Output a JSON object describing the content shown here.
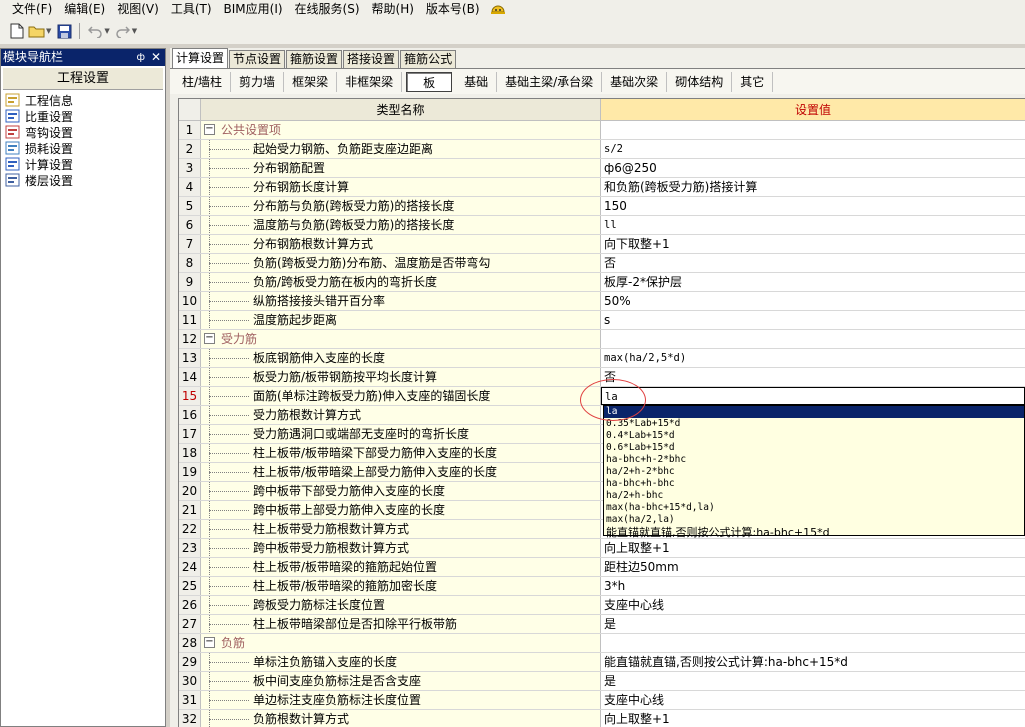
{
  "menu": [
    "文件(F)",
    "编辑(E)",
    "视图(V)",
    "工具(T)",
    "BIM应用(I)",
    "在线服务(S)",
    "帮助(H)",
    "版本号(B)"
  ],
  "left": {
    "title": "模块导航栏",
    "pin": "ф",
    "close": "✕",
    "header": "工程设置",
    "items": [
      "工程信息",
      "比重设置",
      "弯钩设置",
      "损耗设置",
      "计算设置",
      "楼层设置"
    ]
  },
  "tabs": [
    "计算设置",
    "节点设置",
    "箍筋设置",
    "搭接设置",
    "箍筋公式"
  ],
  "subtabs": [
    "柱/墙柱",
    "剪力墙",
    "框架梁",
    "非框架梁",
    "板",
    "基础",
    "基础主梁/承台梁",
    "基础次梁",
    "砌体结构",
    "其它"
  ],
  "grid": {
    "col_name": "类型名称",
    "col_value": "设置值",
    "rows": [
      {
        "n": "1",
        "name": "公共设置项",
        "val": "",
        "group": true
      },
      {
        "n": "2",
        "name": "起始受力钢筋、负筋距支座边距离",
        "val": "s/2"
      },
      {
        "n": "3",
        "name": "分布钢筋配置",
        "val": "ф6@250"
      },
      {
        "n": "4",
        "name": "分布钢筋长度计算",
        "val": "和负筋(跨板受力筋)搭接计算"
      },
      {
        "n": "5",
        "name": "分布筋与负筋(跨板受力筋)的搭接长度",
        "val": "150"
      },
      {
        "n": "6",
        "name": "温度筋与负筋(跨板受力筋)的搭接长度",
        "val": "ll"
      },
      {
        "n": "7",
        "name": "分布钢筋根数计算方式",
        "val": "向下取整+1"
      },
      {
        "n": "8",
        "name": "负筋(跨板受力筋)分布筋、温度筋是否带弯勾",
        "val": "否"
      },
      {
        "n": "9",
        "name": "负筋/跨板受力筋在板内的弯折长度",
        "val": "板厚-2*保护层"
      },
      {
        "n": "10",
        "name": "纵筋搭接接头错开百分率",
        "val": "50%"
      },
      {
        "n": "11",
        "name": "温度筋起步距离",
        "val": "s"
      },
      {
        "n": "12",
        "name": "受力筋",
        "val": "",
        "group": true
      },
      {
        "n": "13",
        "name": "板底钢筋伸入支座的长度",
        "val": "max(ha/2,5*d)"
      },
      {
        "n": "14",
        "name": "板受力筋/板带钢筋按平均长度计算",
        "val": "否"
      },
      {
        "n": "15",
        "name": "面筋(单标注跨板受力筋)伸入支座的锚固长度",
        "val": "la",
        "editing": true
      },
      {
        "n": "16",
        "name": "受力筋根数计算方式",
        "val": ""
      },
      {
        "n": "17",
        "name": "受力筋遇洞口或端部无支座时的弯折长度",
        "val": ""
      },
      {
        "n": "18",
        "name": "柱上板带/板带暗梁下部受力筋伸入支座的长度",
        "val": ""
      },
      {
        "n": "19",
        "name": "柱上板带/板带暗梁上部受力筋伸入支座的长度",
        "val": ""
      },
      {
        "n": "20",
        "name": "跨中板带下部受力筋伸入支座的长度",
        "val": ""
      },
      {
        "n": "21",
        "name": "跨中板带上部受力筋伸入支座的长度",
        "val": ""
      },
      {
        "n": "22",
        "name": "柱上板带受力筋根数计算方式",
        "val": ""
      },
      {
        "n": "23",
        "name": "跨中板带受力筋根数计算方式",
        "val": "向上取整+1"
      },
      {
        "n": "24",
        "name": "柱上板带/板带暗梁的箍筋起始位置",
        "val": "距柱边50mm"
      },
      {
        "n": "25",
        "name": "柱上板带/板带暗梁的箍筋加密长度",
        "val": "3*h"
      },
      {
        "n": "26",
        "name": "跨板受力筋标注长度位置",
        "val": "支座中心线"
      },
      {
        "n": "27",
        "name": "柱上板带暗梁部位是否扣除平行板带筋",
        "val": "是"
      },
      {
        "n": "28",
        "name": "负筋",
        "val": "",
        "group": true
      },
      {
        "n": "29",
        "name": "单标注负筋锚入支座的长度",
        "val": "能直锚就直锚,否则按公式计算:ha-bhc+15*d"
      },
      {
        "n": "30",
        "name": "板中间支座负筋标注是否含支座",
        "val": "是"
      },
      {
        "n": "31",
        "name": "单边标注支座负筋标注长度位置",
        "val": "支座中心线"
      },
      {
        "n": "32",
        "name": "负筋根数计算方式",
        "val": "向上取整+1"
      }
    ]
  },
  "dropdown": [
    "la",
    "0.35*Lab+15*d",
    "0.4*Lab+15*d",
    "0.6*Lab+15*d",
    "ha-bhc+h-2*bhc",
    "ha/2+h-2*bhc",
    "ha-bhc+h-bhc",
    "ha/2+h-bhc",
    "max(ha-bhc+15*d,la)",
    "max(ha/2,la)",
    "能直锚就直锚,否则按公式计算:ha-bhc+15*d"
  ]
}
